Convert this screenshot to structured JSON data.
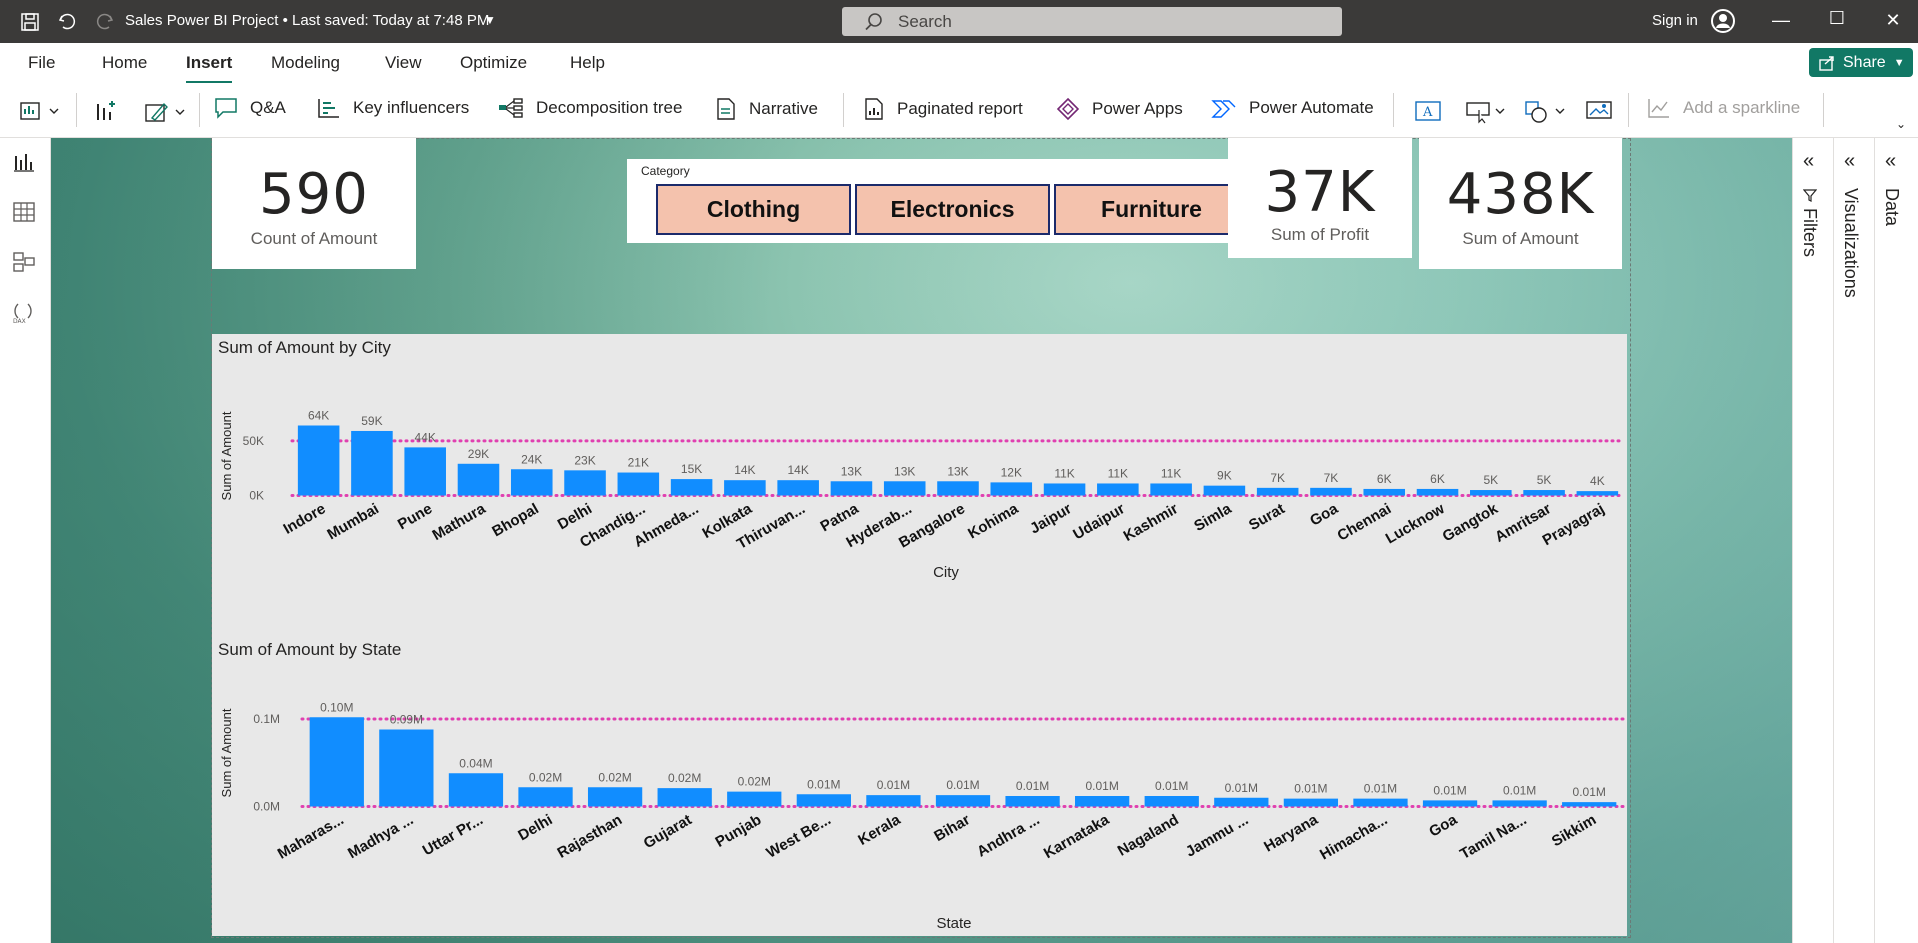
{
  "titlebar": {
    "title": "Sales Power BI Project • Last saved: Today at 7:48 PM",
    "search_placeholder": "Search",
    "signin": "Sign in"
  },
  "menu": {
    "items": [
      "File",
      "Home",
      "Insert",
      "Modeling",
      "View",
      "Optimize",
      "Help"
    ],
    "active": "Insert",
    "share_label": "Share"
  },
  "ribbon": {
    "qa": "Q&A",
    "key_influencers": "Key influencers",
    "decomposition_tree": "Decomposition tree",
    "narrative": "Narrative",
    "paginated_report": "Paginated report",
    "power_apps": "Power Apps",
    "power_automate": "Power Automate",
    "add_sparkline": "Add a sparkline"
  },
  "cards": {
    "count": {
      "value": "590",
      "label": "Count of Amount"
    },
    "profit": {
      "value": "37K",
      "label": "Sum of Profit"
    },
    "amount": {
      "value": "438K",
      "label": "Sum of Amount"
    }
  },
  "slicer": {
    "caption": "Category",
    "options": [
      "Clothing",
      "Electronics",
      "Furniture"
    ]
  },
  "panes": {
    "filters": "Filters",
    "visualizations": "Visualizations",
    "data": "Data"
  },
  "colors": {
    "bar": "#118dff",
    "reference_line": "#e040b0",
    "accent": "#117865"
  },
  "chart_data": [
    {
      "type": "bar",
      "title": "Sum of Amount by City",
      "xlabel": "City",
      "ylabel": "Sum of Amount",
      "ylim": [
        0,
        64000
      ],
      "yticks": [
        "0K",
        "50K"
      ],
      "categories": [
        "Indore",
        "Mumbai",
        "Pune",
        "Mathura",
        "Bhopal",
        "Delhi",
        "Chandig...",
        "Ahmeda...",
        "Kolkata",
        "Thiruvan...",
        "Patna",
        "Hyderab...",
        "Bangalore",
        "Kohima",
        "Jaipur",
        "Udaipur",
        "Kashmir",
        "Simla",
        "Surat",
        "Goa",
        "Chennai",
        "Lucknow",
        "Gangtok",
        "Amritsar",
        "Prayagraj"
      ],
      "values": [
        64000,
        59000,
        44000,
        29000,
        24000,
        23000,
        21000,
        15000,
        14000,
        14000,
        13000,
        13000,
        13000,
        12000,
        11000,
        11000,
        11000,
        9000,
        7000,
        7000,
        6000,
        6000,
        5000,
        5000,
        4000
      ],
      "data_labels": [
        "64K",
        "59K",
        "44K",
        "29K",
        "24K",
        "23K",
        "21K",
        "15K",
        "14K",
        "14K",
        "13K",
        "13K",
        "13K",
        "12K",
        "11K",
        "11K",
        "11K",
        "9K",
        "7K",
        "7K",
        "6K",
        "6K",
        "5K",
        "5K",
        "4K"
      ]
    },
    {
      "type": "bar",
      "title": "Sum of Amount by State",
      "xlabel": "State",
      "ylabel": "Sum of Amount",
      "ylim": [
        0,
        0.1
      ],
      "yticks": [
        "0.0M",
        "0.1M"
      ],
      "categories": [
        "Maharas...",
        "Madhya ...",
        "Uttar Pr...",
        "Delhi",
        "Rajasthan",
        "Gujarat",
        "Punjab",
        "West Be...",
        "Kerala",
        "Bihar",
        "Andhra ...",
        "Karnataka",
        "Nagaland",
        "Jammu ...",
        "Haryana",
        "Himacha...",
        "Goa",
        "Tamil Na...",
        "Sikkim"
      ],
      "values": [
        0.102,
        0.088,
        0.038,
        0.022,
        0.022,
        0.021,
        0.017,
        0.014,
        0.013,
        0.013,
        0.012,
        0.012,
        0.012,
        0.01,
        0.009,
        0.009,
        0.007,
        0.007,
        0.005
      ],
      "data_labels": [
        "0.10M",
        "0.09M",
        "0.04M",
        "0.02M",
        "0.02M",
        "0.02M",
        "0.02M",
        "0.01M",
        "0.01M",
        "0.01M",
        "0.01M",
        "0.01M",
        "0.01M",
        "0.01M",
        "0.01M",
        "0.01M",
        "0.01M",
        "0.01M",
        "0.01M"
      ]
    }
  ]
}
